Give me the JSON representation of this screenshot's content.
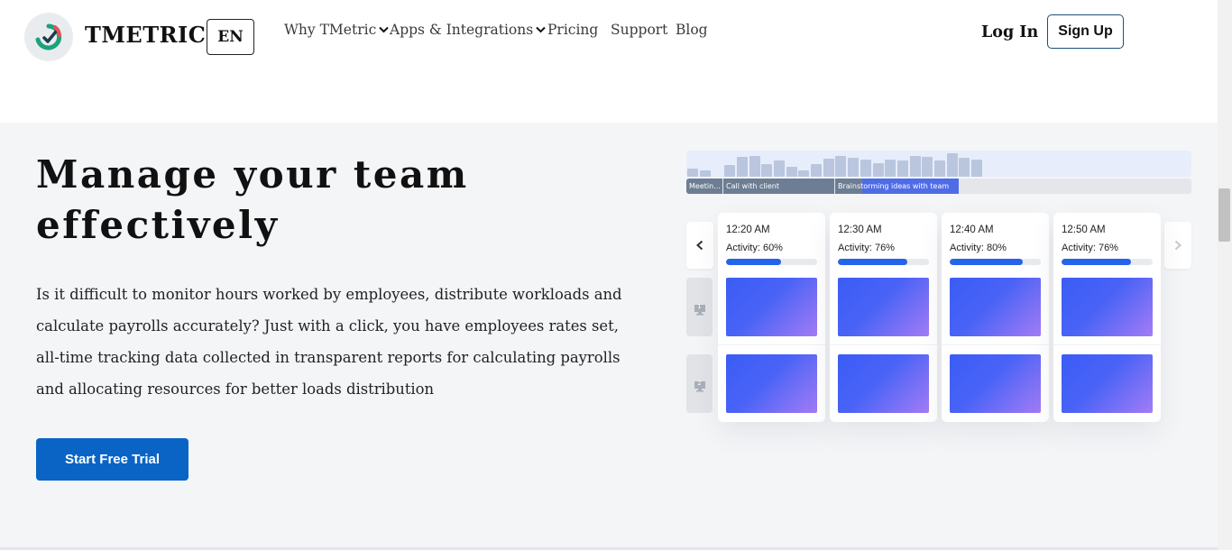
{
  "header": {
    "logo_text": "TMETRIC",
    "lang_label": "EN",
    "nav": [
      {
        "label": "Why TMetric",
        "has_dropdown": true
      },
      {
        "label": "Apps & Integrations",
        "has_dropdown": true
      },
      {
        "label": "Pricing",
        "has_dropdown": false
      },
      {
        "label": "Support",
        "has_dropdown": false
      },
      {
        "label": "Blog",
        "has_dropdown": false
      }
    ],
    "login_label": "Log In",
    "signup_label": "Sign Up"
  },
  "hero": {
    "title_line1": "Manage your team",
    "title_line2": "effectively",
    "description": "Is it difficult to monitor hours worked by employees, distribute workloads and calculate payrolls accurately? Just with a click, you have employees rates set, all-time tracking data collected in transparent reports for calculating payrolls and allocating resources for better loads distribution",
    "cta_label": "Start Free Trial"
  },
  "illustration": {
    "segments": [
      {
        "label": "Meetin..."
      },
      {
        "label": "Call with client"
      },
      {
        "label": "Brainstorming ideas with team"
      }
    ],
    "monitors": [
      "1",
      "2"
    ],
    "cards": [
      {
        "time": "12:20 AM",
        "activity_label": "Activity: 60%",
        "activity": 0.6
      },
      {
        "time": "12:30 AM",
        "activity_label": "Activity: 76%",
        "activity": 0.76
      },
      {
        "time": "12:40 AM",
        "activity_label": "Activity: 80%",
        "activity": 0.8
      },
      {
        "time": "12:50 AM",
        "activity_label": "Activity: 76%",
        "activity": 0.76
      }
    ]
  },
  "colors": {
    "brand_blue": "#0a64c6",
    "progress_blue": "#2563eb",
    "hero_bg": "#f4f5f7",
    "logo_green": "#1aa37a",
    "logo_red": "#e8505b"
  }
}
